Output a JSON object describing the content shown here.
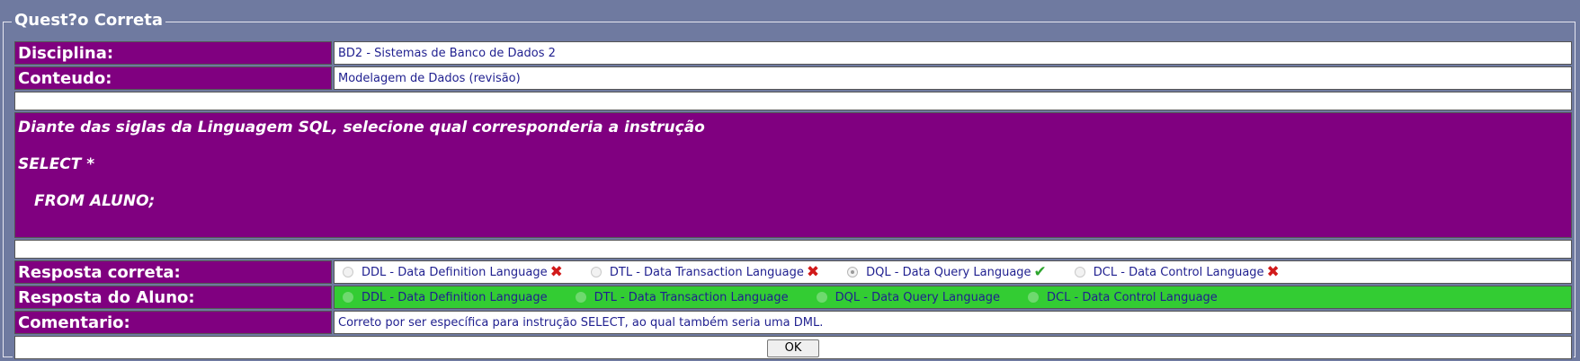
{
  "legend": "Quest?o Correta",
  "disciplina": {
    "label": "Disciplina:",
    "value": "BD2 - Sistemas de Banco de Dados 2"
  },
  "conteudo": {
    "label": "Conteudo:",
    "value": "Modelagem de Dados (revisão)"
  },
  "statement": {
    "line1": "Diante das siglas da Linguagem SQL, selecione qual corresponderia a instrução",
    "line2": "SELECT *",
    "line3": "FROM ALUNO;"
  },
  "resposta_correta": {
    "label": "Resposta correta:",
    "options": [
      {
        "text": "DDL - Data Definition Language",
        "mark": "x-icon"
      },
      {
        "text": "DTL - Data Transaction Language",
        "mark": "x-icon"
      },
      {
        "text": "DQL - Data Query Language",
        "mark": "check-icon"
      },
      {
        "text": "DCL - Data Control Language",
        "mark": "x-icon"
      }
    ],
    "selected": "DQL - Data Query Language"
  },
  "resposta_aluno": {
    "label": "Resposta do Aluno:",
    "options": [
      {
        "text": "DDL - Data Definition Language"
      },
      {
        "text": "DTL - Data Transaction Language"
      },
      {
        "text": "DQL - Data Query Language"
      },
      {
        "text": "DCL - Data Control Language"
      }
    ],
    "row_color": "#33cc33"
  },
  "comentario": {
    "label": "Comentario:",
    "value": "Correto por ser específica para instrução SELECT, ao qual também seria uma DML."
  },
  "ok_button": "OK",
  "colors": {
    "background": "#6f7aa0",
    "label_bg": "#800080",
    "correct_check": "#2ea52e",
    "wrong_x": "#d11a1a"
  }
}
